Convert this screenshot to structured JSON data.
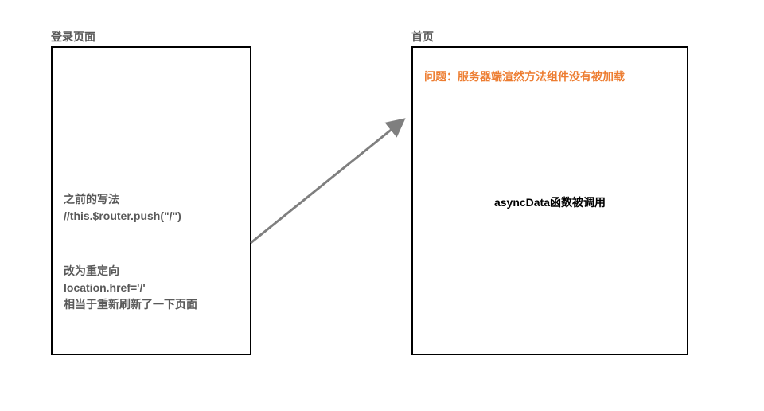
{
  "left": {
    "title": "登录页面",
    "old_method_label": "之前的写法",
    "old_method_code": "//this.$router.push(\"/\")",
    "new_method_label": "改为重定向",
    "new_method_code": "location.href='/'",
    "new_method_note": "相当于重新刷新了一下页面"
  },
  "right": {
    "title": "首页",
    "problem": "问题：服务器端渲然方法组件没有被加载",
    "async_text": "asyncData函数被调用"
  }
}
